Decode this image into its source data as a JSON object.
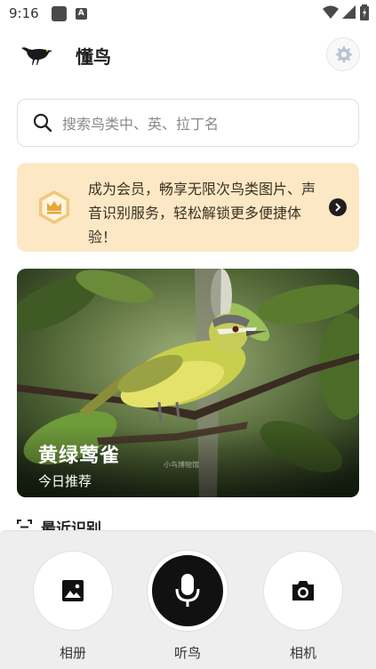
{
  "status_bar": {
    "time": "9:16",
    "notif_letter": "A"
  },
  "header": {
    "title": "懂鸟"
  },
  "search": {
    "placeholder": "搜索鸟类中、英、拉丁名"
  },
  "vip_banner": {
    "text": "成为会员，畅享无限次鸟类图片、声音识别服务，轻松解锁更多便捷体验！"
  },
  "featured": {
    "name": "黄绿莺雀",
    "subtitle": "今日推荐",
    "watermark": "小鸟博物馆"
  },
  "recent": {
    "title": "最近识别"
  },
  "actions": {
    "album": "相册",
    "listen": "听鸟",
    "camera": "相机"
  },
  "colors": {
    "banner_bg": "#fde8c5",
    "mic_bg": "#111111",
    "panel_bg": "#eeeeee"
  }
}
